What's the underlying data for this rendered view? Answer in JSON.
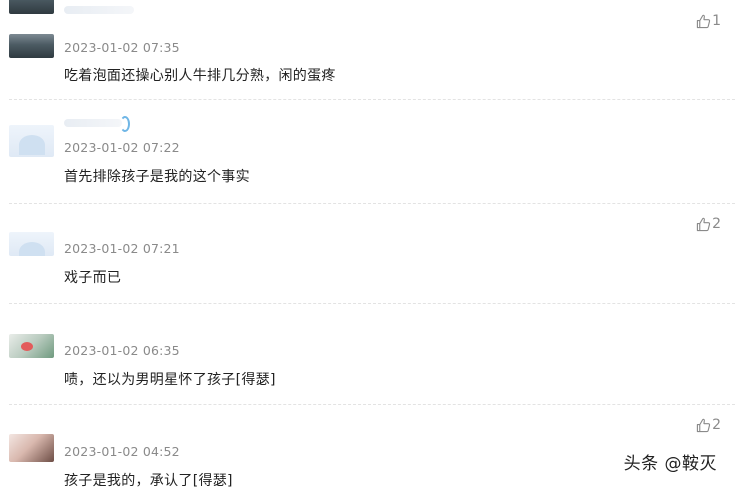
{
  "comments": [
    {
      "time": "2023-01-02 07:35",
      "text": "吃着泡面还操心别人牛排几分熟，闲的蛋疼",
      "likes": "1"
    },
    {
      "time": "2023-01-02 07:22",
      "text": "首先排除孩子是我的这个事实",
      "likes": ""
    },
    {
      "time": "2023-01-02 07:21",
      "text": "戏子而已",
      "likes": "2"
    },
    {
      "time": "2023-01-02 06:35",
      "text": "啧，还以为男明星怀了孩子[得瑟]",
      "likes": ""
    },
    {
      "time": "2023-01-02 04:52",
      "text": "孩子是我的，承认了[得瑟]",
      "likes": "2"
    }
  ],
  "watermark": "头条 @鞍灭",
  "icons": {
    "like": "thumbs-up-icon"
  },
  "colors": {
    "meta_text": "#8a8a8a",
    "body_text": "#222222",
    "divider": "#e3e3e3"
  }
}
